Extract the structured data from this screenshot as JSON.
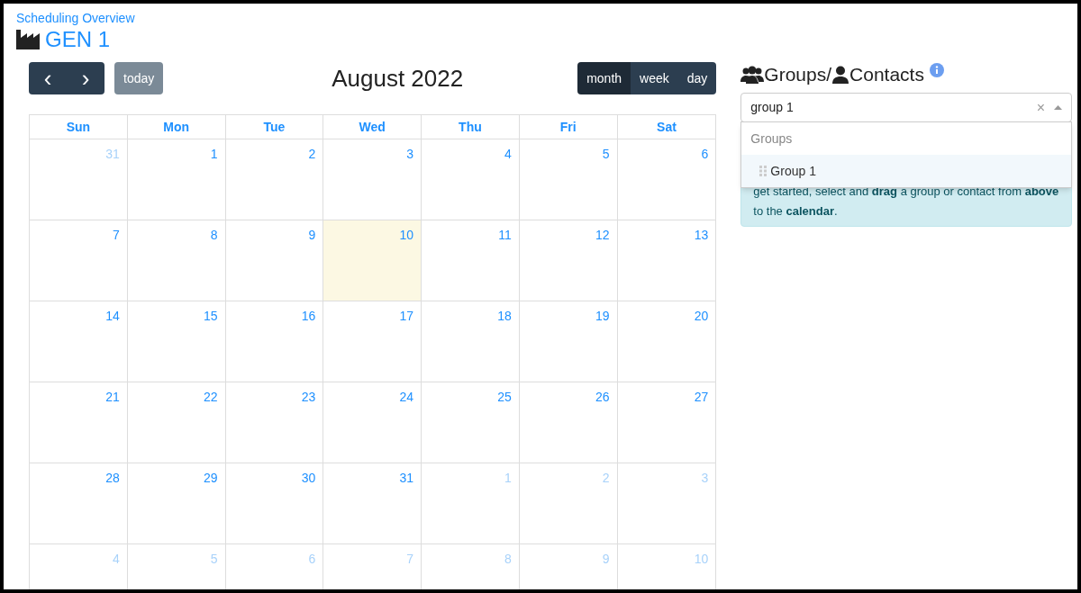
{
  "breadcrumb": "Scheduling Overview",
  "page_title": "GEN 1",
  "toolbar": {
    "prev": "‹",
    "next": "›",
    "today": "today",
    "title": "August 2022",
    "views": [
      {
        "label": "month",
        "selected": true
      },
      {
        "label": "week",
        "selected": false
      },
      {
        "label": "day",
        "selected": false
      }
    ]
  },
  "calendar": {
    "weekdays": [
      "Sun",
      "Mon",
      "Tue",
      "Wed",
      "Thu",
      "Fri",
      "Sat"
    ],
    "weeks": [
      [
        {
          "day": "31",
          "other_month": true,
          "today": false
        },
        {
          "day": "1",
          "other_month": false,
          "today": false
        },
        {
          "day": "2",
          "other_month": false,
          "today": false
        },
        {
          "day": "3",
          "other_month": false,
          "today": false
        },
        {
          "day": "4",
          "other_month": false,
          "today": false
        },
        {
          "day": "5",
          "other_month": false,
          "today": false
        },
        {
          "day": "6",
          "other_month": false,
          "today": false
        }
      ],
      [
        {
          "day": "7",
          "other_month": false,
          "today": false
        },
        {
          "day": "8",
          "other_month": false,
          "today": false
        },
        {
          "day": "9",
          "other_month": false,
          "today": false
        },
        {
          "day": "10",
          "other_month": false,
          "today": true
        },
        {
          "day": "11",
          "other_month": false,
          "today": false
        },
        {
          "day": "12",
          "other_month": false,
          "today": false
        },
        {
          "day": "13",
          "other_month": false,
          "today": false
        }
      ],
      [
        {
          "day": "14",
          "other_month": false,
          "today": false
        },
        {
          "day": "15",
          "other_month": false,
          "today": false
        },
        {
          "day": "16",
          "other_month": false,
          "today": false
        },
        {
          "day": "17",
          "other_month": false,
          "today": false
        },
        {
          "day": "18",
          "other_month": false,
          "today": false
        },
        {
          "day": "19",
          "other_month": false,
          "today": false
        },
        {
          "day": "20",
          "other_month": false,
          "today": false
        }
      ],
      [
        {
          "day": "21",
          "other_month": false,
          "today": false
        },
        {
          "day": "22",
          "other_month": false,
          "today": false
        },
        {
          "day": "23",
          "other_month": false,
          "today": false
        },
        {
          "day": "24",
          "other_month": false,
          "today": false
        },
        {
          "day": "25",
          "other_month": false,
          "today": false
        },
        {
          "day": "26",
          "other_month": false,
          "today": false
        },
        {
          "day": "27",
          "other_month": false,
          "today": false
        }
      ],
      [
        {
          "day": "28",
          "other_month": false,
          "today": false
        },
        {
          "day": "29",
          "other_month": false,
          "today": false
        },
        {
          "day": "30",
          "other_month": false,
          "today": false
        },
        {
          "day": "31",
          "other_month": false,
          "today": false
        },
        {
          "day": "1",
          "other_month": true,
          "today": false
        },
        {
          "day": "2",
          "other_month": true,
          "today": false
        },
        {
          "day": "3",
          "other_month": true,
          "today": false
        }
      ],
      [
        {
          "day": "4",
          "other_month": true,
          "today": false
        },
        {
          "day": "5",
          "other_month": true,
          "today": false
        },
        {
          "day": "6",
          "other_month": true,
          "today": false
        },
        {
          "day": "7",
          "other_month": true,
          "today": false
        },
        {
          "day": "8",
          "other_month": true,
          "today": false
        },
        {
          "day": "9",
          "other_month": true,
          "today": false
        },
        {
          "day": "10",
          "other_month": true,
          "today": false
        }
      ]
    ]
  },
  "sidebar": {
    "heading_groups": "Groups/",
    "heading_contacts": "Contacts",
    "search": {
      "value": "group 1",
      "clear": "×"
    },
    "dropdown": {
      "group_header": "Groups",
      "options": [
        {
          "label": "Group 1",
          "selected": true
        }
      ]
    },
    "hint": "get started, select and **drag** a group or contact from **above** to the **calendar**."
  }
}
